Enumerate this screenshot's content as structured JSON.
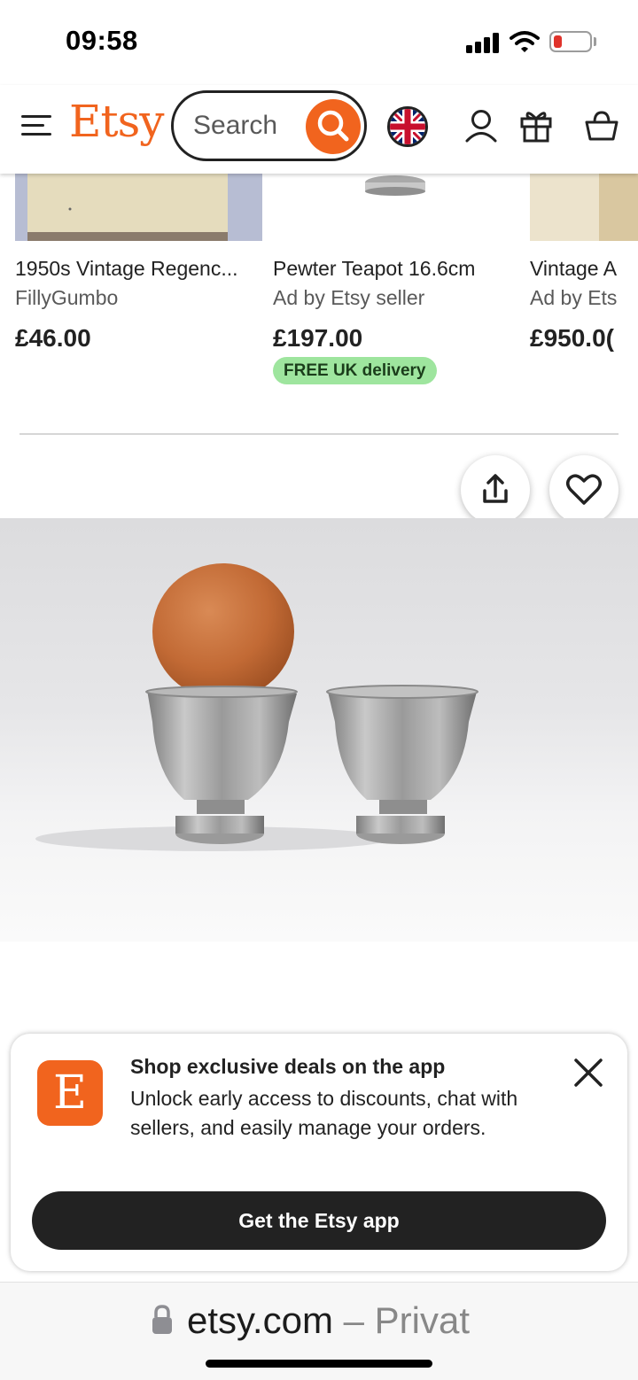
{
  "status_bar": {
    "time": "09:58",
    "icons": [
      "cellular-signal-icon",
      "wifi-icon",
      "battery-low-icon"
    ]
  },
  "header": {
    "logo": "Etsy",
    "search_placeholder": "Search",
    "icons": [
      "menu-icon",
      "search-icon",
      "uk-flag-icon",
      "account-icon",
      "gift-icon",
      "basket-icon"
    ],
    "accent_color": "#f1641e"
  },
  "carousel": {
    "items": [
      {
        "title": "1950s Vintage Regenc...",
        "seller": "FillyGumbo",
        "price": "£46.00"
      },
      {
        "title": "Pewter Teapot 16.6cm",
        "seller": "Ad by Etsy seller",
        "price": "£197.00",
        "badge": "FREE UK delivery"
      },
      {
        "title": "Vintage A",
        "seller": "Ad by Ets",
        "price": "£950.0("
      }
    ]
  },
  "listing": {
    "actions": [
      "share-icon",
      "heart-icon"
    ],
    "photo": "egg-in-pewter-egg-cups"
  },
  "promo": {
    "title": "Shop exclusive deals on the app",
    "text": "Unlock early access to discounts, chat with sellers, and easily manage your orders.",
    "button": "Get the Etsy app",
    "logo_letter": "E"
  },
  "browser": {
    "url": "etsy.com",
    "suffix": " – Privat"
  }
}
